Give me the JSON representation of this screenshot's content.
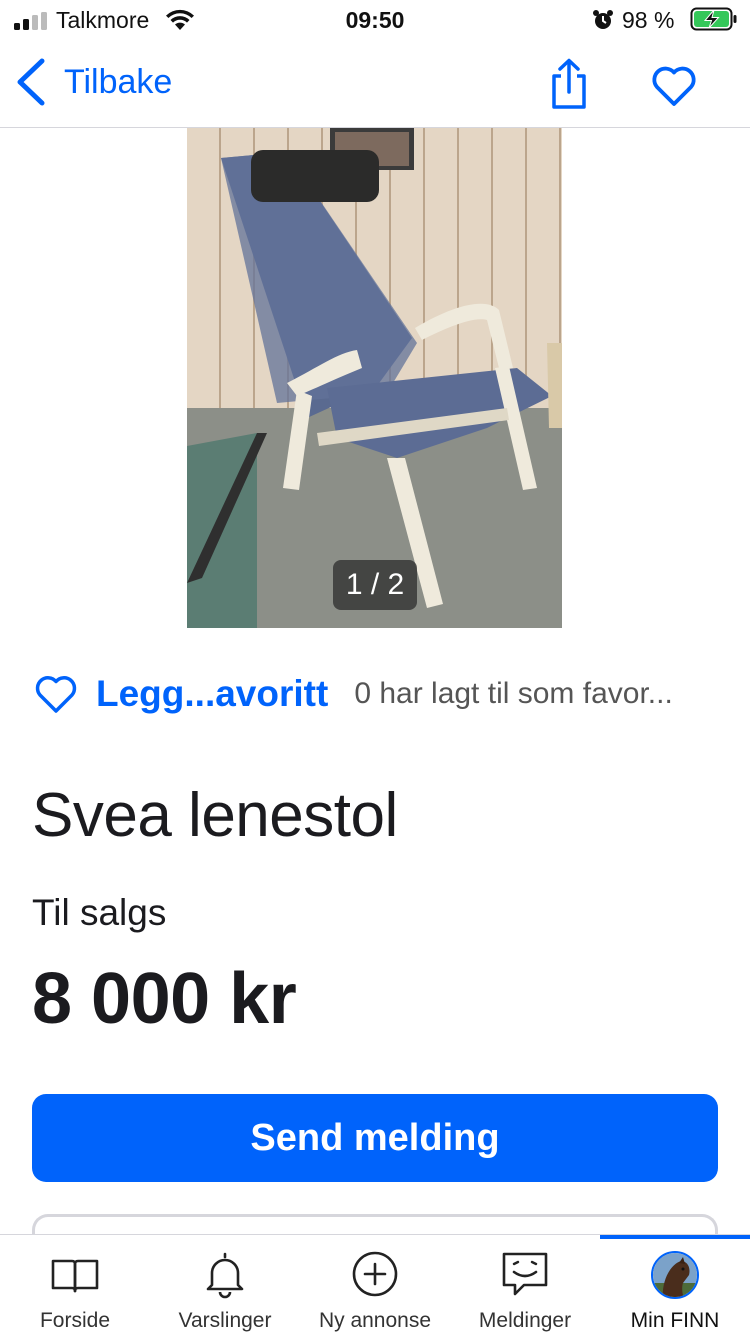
{
  "status_bar": {
    "carrier": "Talkmore",
    "time": "09:50",
    "battery": "98 %",
    "icons": [
      "signal-icon",
      "wifi-icon",
      "alarm-icon",
      "battery-charging-icon"
    ]
  },
  "nav": {
    "back_label": "Tilbake",
    "icons": [
      "chevron-left-icon",
      "share-icon",
      "heart-icon"
    ]
  },
  "gallery": {
    "counter": "1 / 2",
    "current": 1,
    "total": 2
  },
  "favorite": {
    "label": "Legg...avoritt",
    "count_text": "0 har lagt til som favor..."
  },
  "listing": {
    "title": "Svea lenestol",
    "sale_type": "Til salgs",
    "price": "8 000 kr"
  },
  "actions": {
    "send_message": "Send melding"
  },
  "tab_bar": {
    "tabs": [
      {
        "label": "Forside",
        "icon": "book-icon"
      },
      {
        "label": "Varslinger",
        "icon": "bell-icon"
      },
      {
        "label": "Ny annonse",
        "icon": "plus-circle-icon"
      },
      {
        "label": "Meldinger",
        "icon": "chat-smile-icon"
      },
      {
        "label": "Min FINN",
        "icon": "avatar"
      }
    ],
    "active": "Min FINN"
  },
  "colors": {
    "accent": "#0063fb",
    "text": "#1b1b1f",
    "muted": "#555555",
    "divider": "#d6d6dc"
  }
}
